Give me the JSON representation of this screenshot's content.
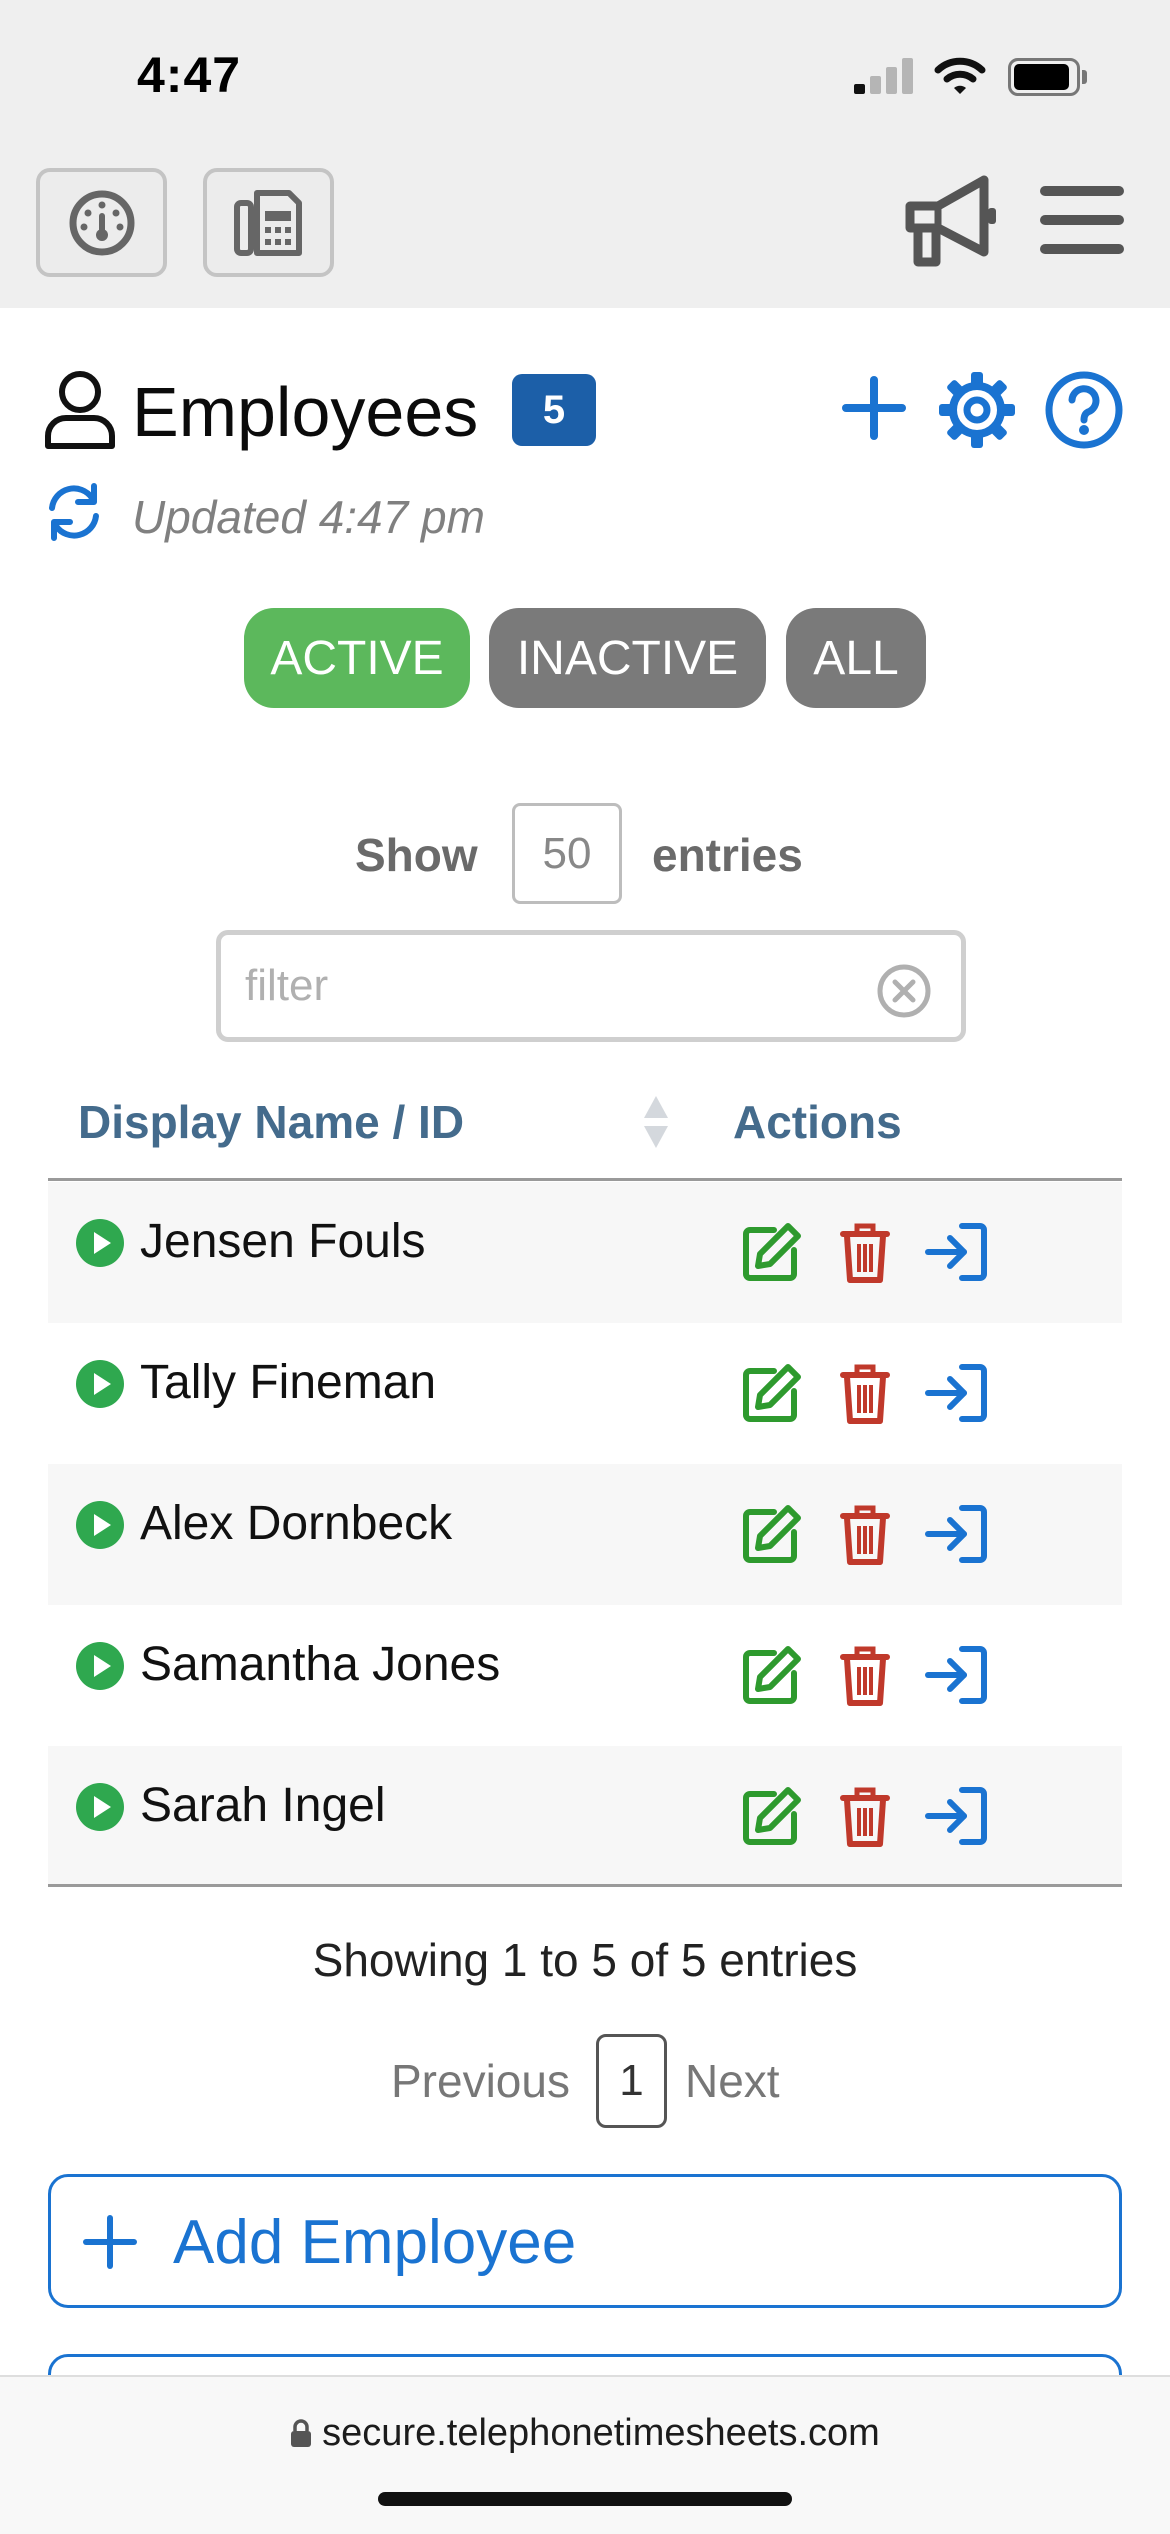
{
  "status_bar": {
    "time": "4:47"
  },
  "toolbar": {
    "left_buttons": [
      "dashboard-icon",
      "fax-machine-icon"
    ],
    "right_icons": [
      "megaphone-icon",
      "hamburger-menu-icon"
    ]
  },
  "header": {
    "title": "Employees",
    "count": "5",
    "updated": "Updated 4:47 pm",
    "actions": [
      "plus-icon",
      "gear-icon",
      "question-circle-icon"
    ]
  },
  "filters": {
    "active": "ACTIVE",
    "inactive": "INACTIVE",
    "all": "ALL",
    "selected": "ACTIVE"
  },
  "length": {
    "show": "Show",
    "value": "50",
    "entries": "entries"
  },
  "search": {
    "placeholder": "filter"
  },
  "table": {
    "columns": [
      "Display Name / ID",
      "Actions"
    ],
    "rows": [
      {
        "name": "Jensen Fouls"
      },
      {
        "name": "Tally Fineman"
      },
      {
        "name": "Alex Dornbeck"
      },
      {
        "name": "Samantha Jones"
      },
      {
        "name": "Sarah Ingel"
      }
    ],
    "info": "Showing 1 to 5 of 5 entries"
  },
  "pagination": {
    "previous": "Previous",
    "current": "1",
    "next": "Next"
  },
  "add_button": {
    "label": "Add Employee"
  },
  "browser": {
    "url": "secure.telephonetimesheets.com"
  },
  "colors": {
    "accent": "#1a73d1",
    "active_pill": "#5cb85c",
    "inactive_pill": "#7a7a7a",
    "edit": "#2e9a2e",
    "delete": "#c0392b",
    "badge": "#1c5fa8"
  }
}
